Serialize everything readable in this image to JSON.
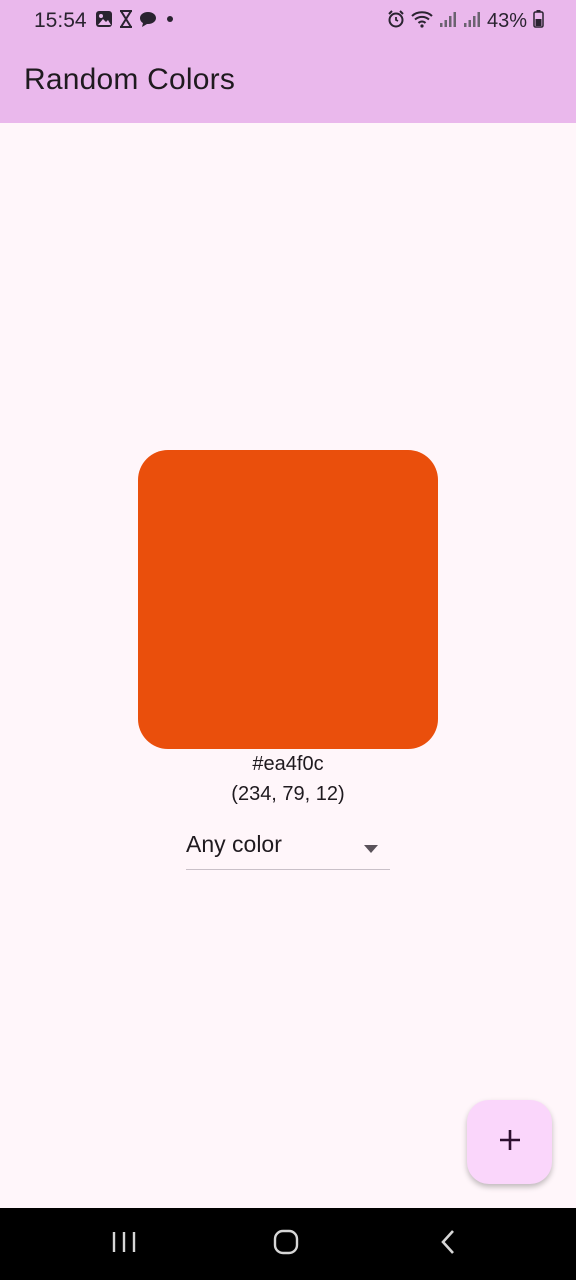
{
  "status_bar": {
    "time": "15:54",
    "battery_percent": "43%",
    "left_icons": [
      "gallery-icon",
      "hourglass-icon",
      "chat-bubble-icon",
      "dot-icon"
    ],
    "right_icons": [
      "alarm-icon",
      "wifi-icon",
      "signal-icon",
      "signal-icon",
      "battery-icon"
    ]
  },
  "app_bar": {
    "title": "Random Colors",
    "background": "#eab8ec"
  },
  "color_display": {
    "swatch_color": "#ea4f0c",
    "hex_label": "#ea4f0c",
    "rgb_label": "(234, 79, 12)"
  },
  "filter_dropdown": {
    "selected": "Any color",
    "icon": "arrow-drop-down-icon"
  },
  "fab": {
    "icon": "add-icon",
    "background": "#fad6fb"
  },
  "nav_bar": {
    "buttons": [
      "recents-icon",
      "home-icon",
      "back-icon"
    ]
  }
}
